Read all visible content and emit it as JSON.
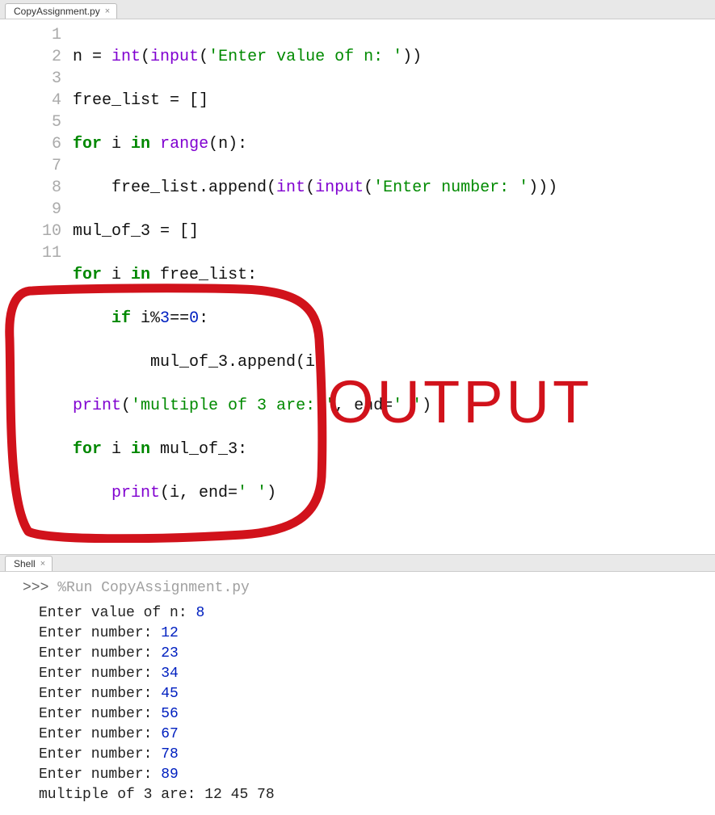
{
  "editor": {
    "tab": {
      "label": "CopyAssignment.py"
    },
    "lineNumbers": [
      "1",
      "2",
      "3",
      "4",
      "5",
      "6",
      "7",
      "8",
      "9",
      "10",
      "11"
    ],
    "code": {
      "l1": {
        "a": "n = ",
        "b": "int",
        "c": "(",
        "d": "input",
        "e": "(",
        "f": "'Enter value of n: '",
        "g": "))"
      },
      "l2": {
        "a": "free_list = []"
      },
      "l3": {
        "a": "for",
        "b": " i ",
        "c": "in",
        "d": " ",
        "e": "range",
        "f": "(n):"
      },
      "l4": {
        "a": "    free_list.append(",
        "b": "int",
        "c": "(",
        "d": "input",
        "e": "(",
        "f": "'Enter number: '",
        "g": ")))"
      },
      "l5": {
        "a": "mul_of_3 = []"
      },
      "l6": {
        "a": "for",
        "b": " i ",
        "c": "in",
        "d": " free_list:"
      },
      "l7": {
        "a": "    ",
        "b": "if",
        "c": " i%",
        "d": "3",
        "e": "==",
        "f": "0",
        "g": ":"
      },
      "l8": {
        "a": "        mul_of_3.append(i)"
      },
      "l9": {
        "a": "print",
        "b": "(",
        "c": "'multiple of 3 are: '",
        "d": ", end=",
        "e": "' '",
        "f": ")"
      },
      "l10": {
        "a": "for",
        "b": " i ",
        "c": "in",
        "d": " mul_of_3:"
      },
      "l11": {
        "a": "    ",
        "b": "print",
        "c": "(i, end=",
        "d": "' '",
        "e": ")"
      }
    }
  },
  "shell": {
    "tab": {
      "label": "Shell"
    },
    "prompt": ">>> ",
    "run_cmd": "%Run CopyAssignment.py",
    "io": [
      {
        "text": "Enter value of n: ",
        "val": "8"
      },
      {
        "text": "Enter number: ",
        "val": "12"
      },
      {
        "text": "Enter number: ",
        "val": "23"
      },
      {
        "text": "Enter number: ",
        "val": "34"
      },
      {
        "text": "Enter number: ",
        "val": "45"
      },
      {
        "text": "Enter number: ",
        "val": "56"
      },
      {
        "text": "Enter number: ",
        "val": "67"
      },
      {
        "text": "Enter number: ",
        "val": "78"
      },
      {
        "text": "Enter number: ",
        "val": "89"
      }
    ],
    "result": "multiple of 3 are:  12 45 78"
  },
  "annotation": {
    "label": "OUTPUT",
    "color": "#d1121b"
  }
}
